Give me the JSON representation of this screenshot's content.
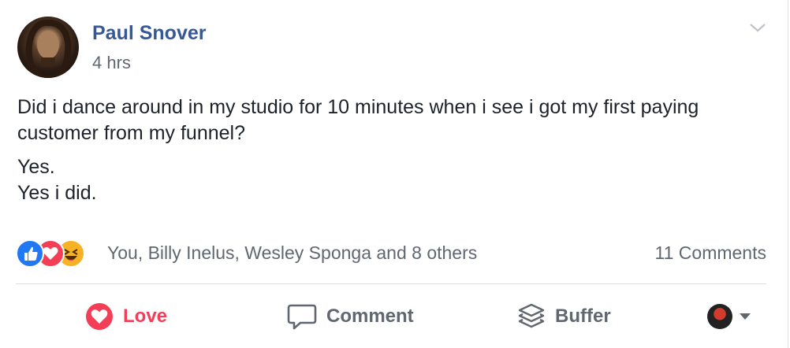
{
  "post": {
    "author": "Paul Snover",
    "timestamp": "4 hrs",
    "paragraphs": [
      "Did i dance around in my studio for 10 minutes when i see i got my first paying customer from my funnel?",
      "Yes.",
      "Yes i did."
    ]
  },
  "reactions": {
    "icons": [
      "like-icon",
      "love-icon",
      "haha-icon"
    ],
    "names": "You, Billy Inelus, Wesley Sponga and 8 others",
    "comments": "11 Comments"
  },
  "actions": {
    "love": "Love",
    "comment": "Comment",
    "buffer": "Buffer"
  },
  "colors": {
    "author_link": "#365899",
    "love_red": "#f33e58",
    "like_blue": "#2078f4",
    "haha_yellow": "#f7b125",
    "meta_gray": "#616770"
  }
}
